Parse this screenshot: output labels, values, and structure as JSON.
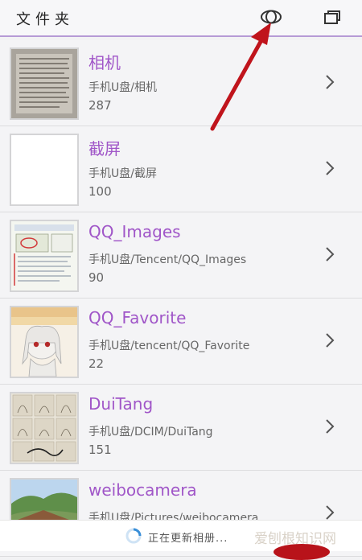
{
  "header": {
    "title": "文件夹",
    "icons": [
      "eye-icon",
      "window-icon"
    ]
  },
  "folders": [
    {
      "name": "相机",
      "path": "手机U盘/相机",
      "count": "287",
      "thumb": "document-photo"
    },
    {
      "name": "截屏",
      "path": "手机U盘/截屏",
      "count": "100",
      "thumb": "blank"
    },
    {
      "name": "QQ_Images",
      "path": "手机U盘/Tencent/QQ_Images",
      "count": "90",
      "thumb": "screenshot"
    },
    {
      "name": "QQ_Favorite",
      "path": "手机U盘/tencent/QQ_Favorite",
      "count": "22",
      "thumb": "anime-girl"
    },
    {
      "name": "DuiTang",
      "path": "手机U盘/DCIM/DuiTang",
      "count": "151",
      "thumb": "sketches"
    },
    {
      "name": "weibocamera",
      "path": "手机U盘/Pictures/weibocamera",
      "count": "",
      "thumb": "landscape"
    }
  ],
  "footer": {
    "loading_text": "正在更新相册...",
    "watermark": "爱刨根知识网"
  },
  "colors": {
    "accent": "#a056c8",
    "header_rule": "#b69ad6",
    "annotation_arrow": "#c0141c"
  }
}
